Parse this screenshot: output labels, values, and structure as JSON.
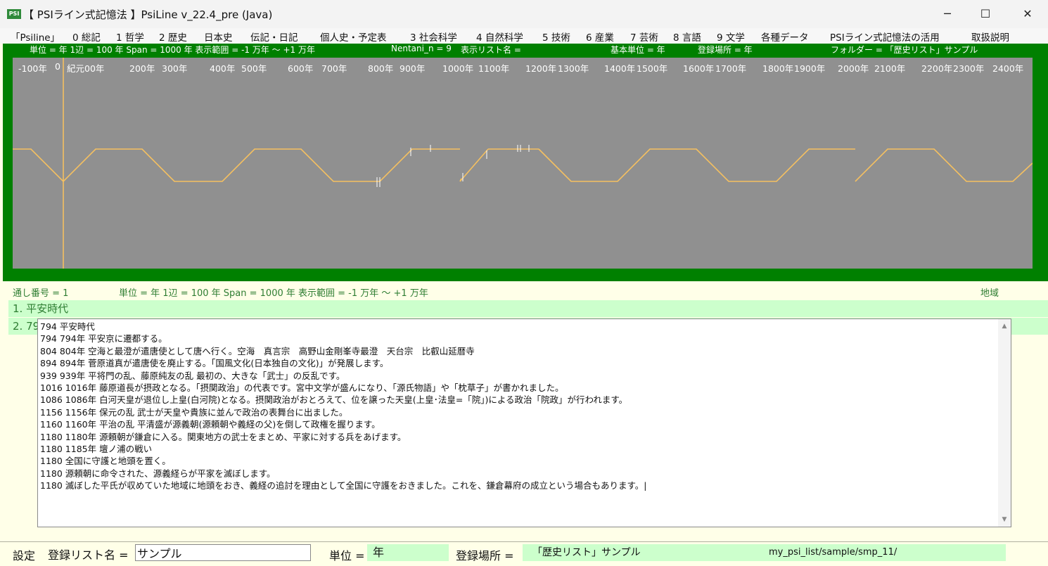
{
  "window": {
    "logo_text": "PSI",
    "title": "【 PSIライン式記憶法 】PsiLine v_22.4_pre (Java)",
    "minimize": "─",
    "maximize": "☐",
    "close": "✕"
  },
  "menu": [
    "「Psiline」",
    "0 総記",
    "1 哲学",
    "2 歴史",
    "日本史",
    "伝記・日記",
    "個人史・予定表",
    "3 社会科学",
    "4 自然科学",
    "5 技術",
    "6 産業",
    "7 芸術",
    "8 言語",
    "9 文学",
    "各種データ",
    "PSIライン式記憶法の活用",
    "取扱説明"
  ],
  "timeline": {
    "info": {
      "scale": "単位 = 年  1辺 = 100 年  Span = 1000 年  表示範囲 = -1 万年 〜 +1 万年",
      "nentani": "Nentani_n = 9",
      "list_name": "表示リスト名 =",
      "base_unit": "基本単位 = 年",
      "location": "登録場所 = 年",
      "folder": "フォルダー = 「歴史リスト」サンプル"
    },
    "year_labels": [
      "-100年",
      "0",
      "紀元00年",
      "200年",
      "300年",
      "400年",
      "500年",
      "600年",
      "700年",
      "800年",
      "900年",
      "1000年",
      "1100年",
      "1200年",
      "1300年",
      "1400年",
      "1500年",
      "1600年",
      "1700年",
      "1800年",
      "1900年",
      "2000年",
      "2100年",
      "2200年",
      "2300年",
      "2400年"
    ],
    "colors": {
      "panel": "#008000",
      "canvas": "#909090",
      "line": "#f5c060"
    }
  },
  "status": {
    "serial": "通し番号 = 1",
    "summary": "単位 = 年  1辺 = 100 年  Span = 1000 年  表示範囲 = -1 万年 〜 +1 万年",
    "region": "地域"
  },
  "list_rows": [
    "1. 平安時代",
    "2. 79"
  ],
  "notes": [
    "794  平安時代",
    "794  794年 平安京に遷都する。",
    "804  804年 空海と最澄が遣唐使として唐へ行く。空海　真言宗　高野山金剛峯寺最澄　天台宗　比叡山延暦寺",
    "894  894年 菅原道真が遣唐使を廃止する。「国風文化(日本独自の文化)」が発展します。",
    "939  939年 平将門の乱、藤原純友の乱 最初の、大きな「武士」の反乱です。",
    "1016  1016年 藤原道長が摂政となる。「摂関政治」の代表です。宮中文学が盛んになり、「源氏物語」や「枕草子」が書かれました。",
    "1086  1086年 白河天皇が退位し上皇(白河院)となる。摂関政治がおとろえて、位を譲った天皇(上皇･法皇=「院」)による政治「院政」が行われます。",
    "1156  1156年 保元の乱 武士が天皇や貴族に並んで政治の表舞台に出ました。",
    "1160  1160年 平治の乱 平清盛が源義朝(源頼朝や義経の父)を倒して政権を握ります。",
    "1180  1180年 源頼朝が鎌倉に入る。関東地方の武士をまとめ、平家に対する兵をあげます。",
    "1180  1185年 壇ノ浦の戦い",
    "1180  全国に守護と地頭を置く。",
    "1180  源頼朝に命令された、源義経らが平家を滅ぼします。",
    "1180  滅ぼした平氏が収めていた地域に地頭をおき、義経の追討を理由として全国に守護をおきました。これを、鎌倉幕府の成立という場合もあります。|"
  ],
  "settings": {
    "label": "設定",
    "list_name_label": "登録リスト名 =",
    "list_name_value": "サンプル",
    "unit_label": "単位 =",
    "unit_value": "年",
    "location_label": "登録場所 =",
    "location_value": "「歴史リスト」サンプル",
    "location_path": "my_psi_list/sample/smp_11/"
  }
}
